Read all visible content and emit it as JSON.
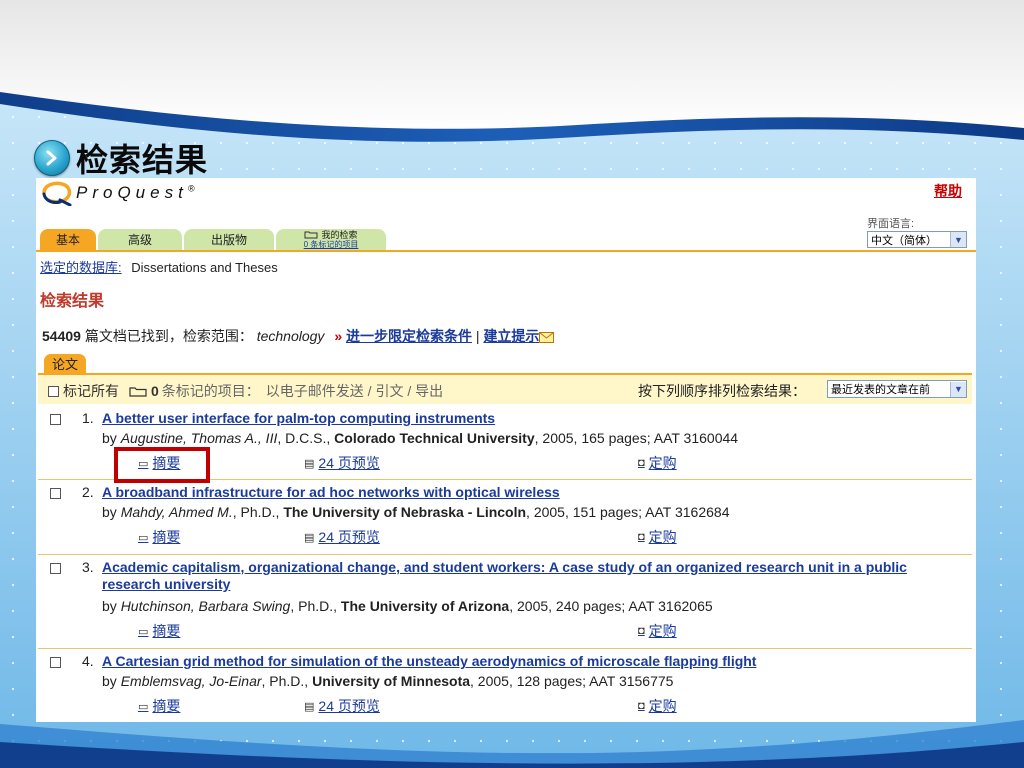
{
  "slide": {
    "title": "检索结果"
  },
  "header": {
    "logo_text": "ProQuest",
    "logo_mark": "®",
    "help": "帮助",
    "ui_language_label": "界面语言:",
    "ui_language_value": "中文（简体）"
  },
  "tabs": [
    {
      "label": "基本",
      "active": true
    },
    {
      "label": "高级"
    },
    {
      "label": "出版物"
    },
    {
      "label": "我的检索",
      "sub": "0 条标记的项目"
    }
  ],
  "database": {
    "label": "选定的数据库:",
    "value": "Dissertations and Theses"
  },
  "results_heading": "检索结果",
  "count": {
    "number": "54409",
    "text": "篇文档已找到，检索范围：",
    "term": "technology",
    "raquo": "»",
    "refine": "进一步限定检索条件",
    "separator": "|",
    "alert": "建立提示"
  },
  "doc_tab": "论文",
  "toolbar": {
    "mark_all": "标记所有",
    "marked_count": "0",
    "marked_text": "条标记的项目：",
    "actions": "以电子邮件发送 / 引文 / 导出",
    "sort_label": "按下列顺序排列检索结果：",
    "sort_value": "最近发表的文章在前"
  },
  "results": [
    {
      "index": "1.",
      "title": "A better user interface for palm-top computing instruments",
      "by": "by",
      "author": "Augustine, Thomas A., III",
      "degree": ", D.C.S., ",
      "school": "Colorado Technical University",
      "details": ", 2005, 165 pages; AAT 3160044",
      "abstract": "摘要",
      "preview": "24 页预览",
      "order": "定购"
    },
    {
      "index": "2.",
      "title": "A broadband infrastructure for ad hoc networks with optical wireless",
      "by": "by",
      "author": "Mahdy, Ahmed M.",
      "degree": ", Ph.D., ",
      "school": "The University of Nebraska - Lincoln",
      "details": ", 2005, 151 pages; AAT 3162684",
      "abstract": "摘要",
      "preview": "24 页预览",
      "order": "定购"
    },
    {
      "index": "3.",
      "title": "Academic capitalism, organizational change, and student workers: A case study of an organized research unit in a public research university",
      "by": "by",
      "author": "Hutchinson, Barbara Swing",
      "degree": ", Ph.D., ",
      "school": "The University of Arizona",
      "details": ", 2005, 240 pages; AAT 3162065",
      "abstract": "摘要",
      "order": "定购"
    },
    {
      "index": "4.",
      "title": "A Cartesian grid method for simulation of the unsteady aerodynamics of microscale flapping flight",
      "by": "by",
      "author": "Emblemsvag, Jo-Einar",
      "degree": ", Ph.D., ",
      "school": "University of Minnesota",
      "details": ", 2005, 128 pages; AAT 3156775",
      "abstract": "摘要",
      "preview": "24 页预览",
      "order": "定购"
    }
  ],
  "colors": {
    "accent_orange": "#f5a623",
    "link_blue": "#1a3a9c",
    "highlight_red": "#c00000"
  }
}
